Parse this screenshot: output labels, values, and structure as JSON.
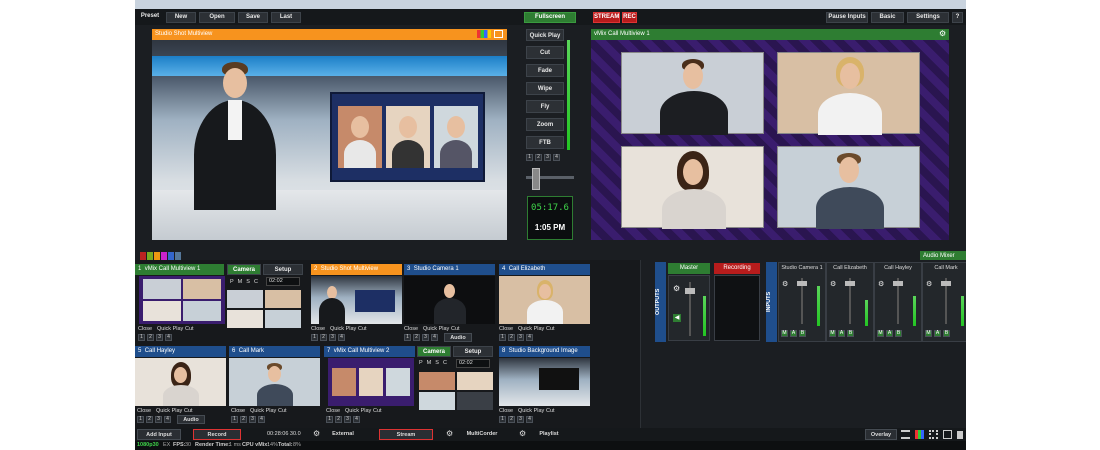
{
  "topbar": {
    "preset": "Preset",
    "new": "New",
    "open": "Open",
    "save": "Save",
    "last": "Last",
    "fullscreen": "Fullscreen",
    "stream": "STREAM",
    "rec": "REC",
    "pause": "Pause Inputs",
    "basic": "Basic",
    "settings": "Settings",
    "help": "?"
  },
  "preview": {
    "title": "Studio Shot  Multiview"
  },
  "output": {
    "title": "vMix Call Multiview 1"
  },
  "transitions": {
    "items": [
      "Quick Play",
      "Cut",
      "Fade",
      "Wipe",
      "Fly",
      "Zoom",
      "FTB"
    ],
    "pages": [
      "1",
      "2",
      "3",
      "4"
    ],
    "timer": "05:17.6",
    "clock": "1:05 PM"
  },
  "audio_mixer": "Audio Mixer",
  "inputs": [
    {
      "num": "1",
      "title": "vMix Call Multiview 1",
      "tab1": "Camera",
      "tab2": "Setup",
      "val": "02:02",
      "close": "Close",
      "qp": "Quick Play",
      "cut": "Cut",
      "nums": [
        "1",
        "2",
        "3",
        "4"
      ]
    },
    {
      "num": "2",
      "title": "Studio Shot Multiview",
      "close": "Close",
      "qp": "Quick Play",
      "cut": "Cut",
      "nums": [
        "1",
        "2",
        "3",
        "4"
      ]
    },
    {
      "num": "3",
      "title": "Studio Camera 1",
      "close": "Close",
      "qp": "Quick Play",
      "cut": "Cut",
      "nums": [
        "1",
        "2",
        "3",
        "4"
      ]
    },
    {
      "num": "4",
      "title": "Call Elizabeth",
      "close": "Close",
      "qp": "Quick Play",
      "cut": "Cut",
      "nums": [
        "1",
        "2",
        "3",
        "4"
      ],
      "audio": "Audio"
    },
    {
      "num": "5",
      "title": "Call Hayley",
      "close": "Close",
      "qp": "Quick Play",
      "cut": "Cut",
      "nums": [
        "1",
        "2",
        "3",
        "4"
      ],
      "audio": "Audio"
    },
    {
      "num": "6",
      "title": "Call Mark",
      "close": "Close",
      "qp": "Quick Play",
      "cut": "Cut",
      "nums": [
        "1",
        "2",
        "3",
        "4"
      ]
    },
    {
      "num": "7",
      "title": "vMix Call Multiview 2",
      "tab1": "Camera",
      "tab2": "Setup",
      "val": "02:02",
      "close": "Close",
      "qp": "Quick Play",
      "cut": "Cut",
      "nums": [
        "1",
        "2",
        "3",
        "4"
      ]
    },
    {
      "num": "8",
      "title": "Studio Background Image",
      "close": "Close",
      "qp": "Quick Play",
      "cut": "Cut",
      "nums": [
        "1",
        "2",
        "3",
        "4"
      ]
    }
  ],
  "mix_letters": [
    "P",
    "M",
    "S",
    "C"
  ],
  "mixer": {
    "outputs": "OUTPUTS",
    "master": "Master",
    "recording": "Recording",
    "inputs_label": "INPUTS",
    "channels": [
      "Studio Camera 1",
      "Call Elizabeth",
      "Call Hayley",
      "Call Mark"
    ],
    "ma": [
      "M",
      "A",
      "B"
    ]
  },
  "bottom": {
    "add_input": "Add Input",
    "record": "Record",
    "rec_time": "00:28:06 30.0",
    "external": "External",
    "stream": "Stream",
    "multicorder": "MultiCorder",
    "playlist": "Playlist",
    "overlay": "Overlay"
  },
  "status": {
    "res": "1080p30",
    "ex": "EX",
    "fps_l": "FPS:",
    "fps": "30",
    "render_l": "Render Time:",
    "render": "1 ms",
    "cpu_l": "CPU vMix:",
    "cpu": "14%",
    "total_l": "Total:",
    "total": "8%"
  },
  "colors": {
    "orange": "#f7931e",
    "green": "#2e7d32",
    "blue": "#1f4e8c",
    "red": "#b71c1c"
  }
}
